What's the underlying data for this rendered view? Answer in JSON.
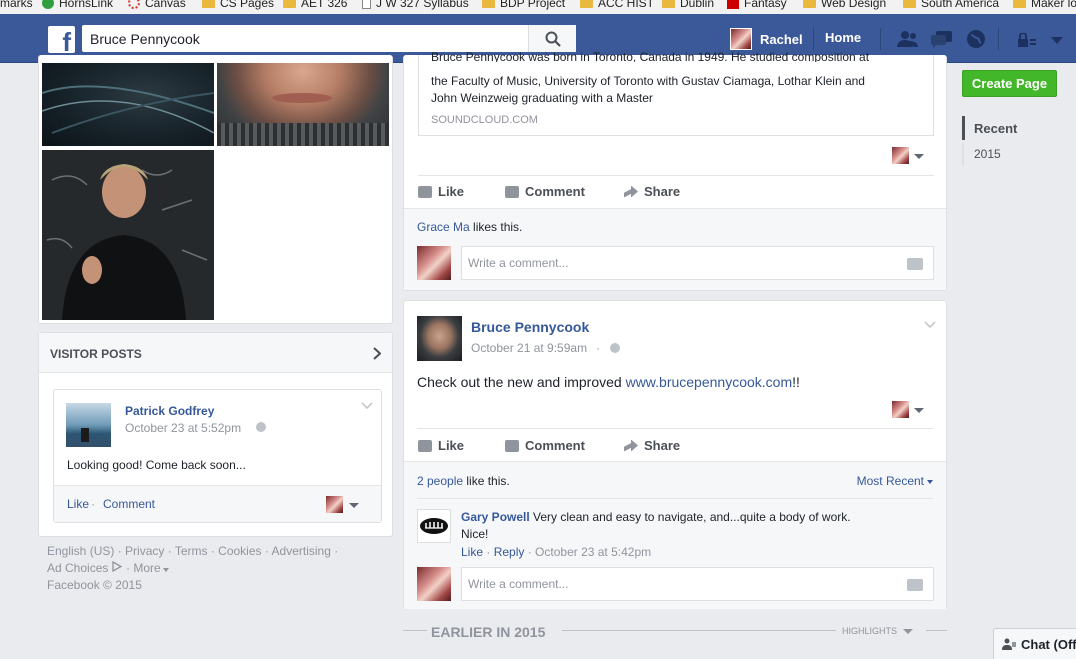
{
  "bookmarks": [
    {
      "label": "marks",
      "icon": "none"
    },
    {
      "label": "HornsLink",
      "icon": "hornslink-icon"
    },
    {
      "label": "Canvas",
      "icon": "canvas-icon"
    },
    {
      "label": "CS Pages",
      "icon": "folder-icon"
    },
    {
      "label": "AET 326",
      "icon": "folder-icon"
    },
    {
      "label": "J W 327 Syllabus",
      "icon": "page-icon"
    },
    {
      "label": "BDP Project",
      "icon": "folder-icon"
    },
    {
      "label": "ACC HIST",
      "icon": "folder-icon"
    },
    {
      "label": "Dublin",
      "icon": "folder-icon"
    },
    {
      "label": "Fantasy",
      "icon": "espn-icon"
    },
    {
      "label": "Web Design",
      "icon": "folder-icon"
    },
    {
      "label": "South America",
      "icon": "folder-icon"
    },
    {
      "label": "Maker lo",
      "icon": "folder-icon"
    }
  ],
  "topbar": {
    "search_value": "Bruce Pennycook",
    "user_name": "Rachel",
    "home_label": "Home",
    "brand_color": "#3b5998"
  },
  "visitor_posts": {
    "header": "VISITOR POSTS",
    "post": {
      "author": "Patrick Godfrey",
      "time": "October 23 at 5:52pm",
      "text": "Looking good! Come back soon...",
      "like": "Like",
      "sep": " · ",
      "comment": "Comment"
    }
  },
  "footer": {
    "line1": [
      "English (US)",
      "Privacy",
      "Terms",
      "Cookies",
      "Advertising"
    ],
    "ad_choices": "Ad Choices",
    "more": "More",
    "copyright": "Facebook © 2015"
  },
  "feed": {
    "top_post": {
      "preview_line0": "Bruce Pennycook was born in Toronto, Canada in 1949. He studied composition at",
      "preview_line1": "the Faculty of Music, University of Toronto with Gustav Ciamaga, Lothar Klein and",
      "preview_line2": "John Weinzweig graduating with a Master",
      "source": "SOUNDCLOUD.COM",
      "like": "Like",
      "comment": "Comment",
      "share": "Share",
      "liker": "Grace Ma",
      "likes_suffix": " likes this.",
      "comment_placeholder": "Write a comment..."
    },
    "post2": {
      "author": "Bruce Pennycook",
      "time": "October 21 at 9:59am",
      "sep": " · ",
      "text_prefix": "Check out the new and improved ",
      "link": "www.brucepennycook.com",
      "text_suffix": "!!",
      "like": "Like",
      "comment": "Comment",
      "share": "Share",
      "people": "2 people",
      "people_suffix": " like this.",
      "sort": "Most Recent",
      "commenter": "Gary Powell",
      "comment_text1": " Very clean and easy to navigate, and...quite a body of work.",
      "comment_text2": "Nice!",
      "c_like": "Like",
      "c_reply": "Reply",
      "c_time": "October 23 at 5:42pm",
      "comment_placeholder": "Write a comment..."
    },
    "earlier": "EARLIER IN 2015",
    "highlights": "HIGHLIGHTS"
  },
  "right": {
    "create_page": "Create Page",
    "create_color": "#42b72a",
    "recent": "Recent",
    "year": "2015"
  },
  "chat": {
    "label": "Chat (Off"
  }
}
